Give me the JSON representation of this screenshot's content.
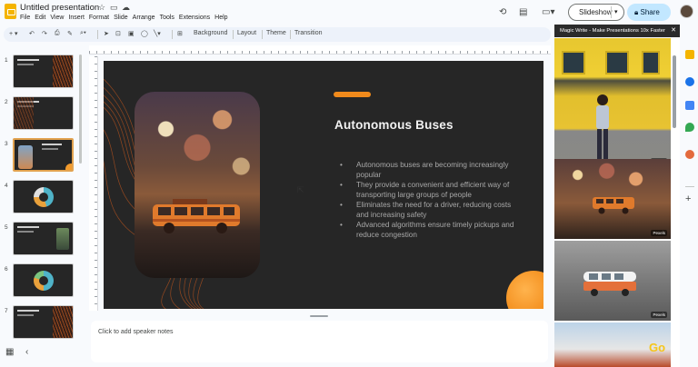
{
  "document": {
    "title": "Untitled presentation",
    "star_icon": "star-icon",
    "move_icon": "folder-icon",
    "cloud_icon": "cloud-icon"
  },
  "menu": [
    "File",
    "Edit",
    "View",
    "Insert",
    "Format",
    "Slide",
    "Arrange",
    "Tools",
    "Extensions",
    "Help"
  ],
  "header": {
    "slideshow_label": "Slideshow",
    "share_label": "Share",
    "icons": [
      "history-icon",
      "comment-icon",
      "video-call-icon"
    ]
  },
  "toolbar": {
    "background_label": "Background",
    "layout_label": "Layout",
    "theme_label": "Theme",
    "transition_label": "Transition"
  },
  "thumbnails": {
    "numbers": [
      "1",
      "2",
      "3",
      "4",
      "5",
      "6",
      "7"
    ],
    "selected": "3"
  },
  "slide": {
    "title": "Autonomous Buses",
    "bullets": [
      "Autonomous buses are becoming increasingly popular",
      "They provide a convenient and efficient way of transporting large groups of people",
      "Eliminates the need for a driver, reducing costs and increasing safety",
      "Advanced algorithms ensure timely pickups and reduce congestion"
    ],
    "accent_color": "#f08a1c",
    "background_color": "#262626"
  },
  "notes": {
    "placeholder": "Click to add speaker notes"
  },
  "side_panel": {
    "title": "Magic Write - Make Presentations 10x Faster",
    "results": [
      {
        "tag": "Pexels"
      },
      {
        "tag": "Pexels"
      },
      {
        "tag": "Pexels"
      }
    ],
    "partial_logo_text": "Go"
  }
}
